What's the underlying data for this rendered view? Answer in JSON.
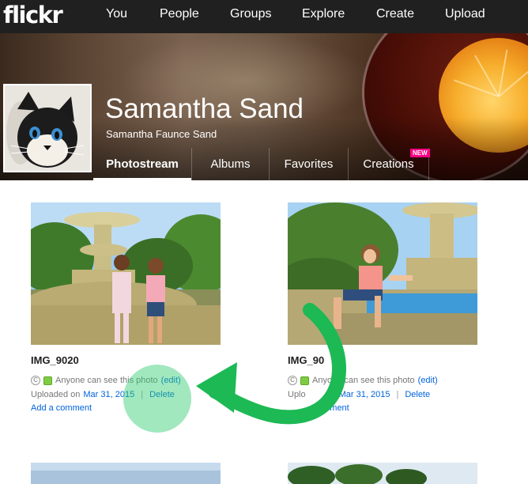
{
  "app": {
    "logo": "flickr"
  },
  "topnav": {
    "items": [
      {
        "label": "You"
      },
      {
        "label": "People"
      },
      {
        "label": "Groups"
      },
      {
        "label": "Explore"
      },
      {
        "label": "Create"
      },
      {
        "label": "Upload"
      }
    ]
  },
  "profile": {
    "name": "Samantha Sand",
    "full_name": "Samantha Faunce Sand"
  },
  "subnav": {
    "tabs": [
      {
        "label": "Photostream",
        "active": true
      },
      {
        "label": "Albums"
      },
      {
        "label": "Favorites"
      },
      {
        "label": "Creations"
      }
    ],
    "new_badge": "NEW"
  },
  "photos": [
    {
      "title": "IMG_9020",
      "privacy_text": "Anyone can see this photo",
      "edit_label": "(edit)",
      "uploaded_prefix": "Uploaded on",
      "uploaded_date": "Mar 31, 2015",
      "delete_label": "Delete",
      "comment_label": "Add a comment"
    },
    {
      "title": "IMG_90",
      "privacy_text": "Anyone can see this photo",
      "edit_label": "(edit)",
      "uploaded_prefix": "Uplo",
      "uploaded_date": "Mar 31, 2015",
      "delete_label": "Delete",
      "comment_label": "omment"
    }
  ],
  "colors": {
    "topbar": "#202020",
    "link": "#0063dc",
    "new_badge": "#ff0084",
    "annotation": "#1db954"
  },
  "icons": {
    "cc": "creative-commons-icon",
    "privacy": "public-privacy-icon"
  }
}
